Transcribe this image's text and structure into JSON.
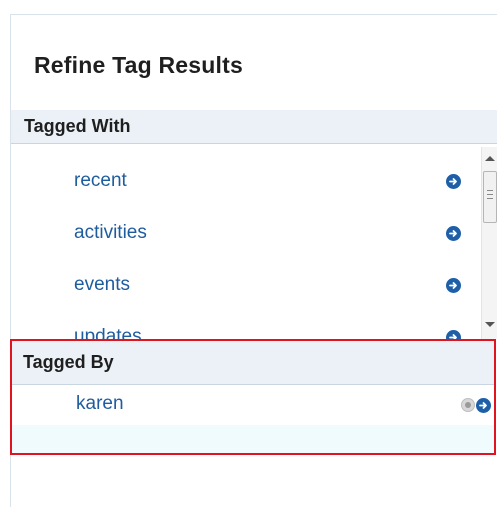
{
  "panel": {
    "title": "Refine Tag Results"
  },
  "tagged_with": {
    "header": "Tagged With",
    "items": [
      {
        "label": "recent"
      },
      {
        "label": "activities"
      },
      {
        "label": "events"
      },
      {
        "label": "updates"
      }
    ],
    "scroll_position": 0.1
  },
  "tagged_by": {
    "header": "Tagged By",
    "items": [
      {
        "label": "karen"
      }
    ]
  },
  "colors": {
    "link": "#1f5c9e",
    "button": "#1e5fa8",
    "header_bg": "#ebf1f6",
    "highlight_border": "#e0141e"
  },
  "icons": {
    "go": "arrow-right-circle-icon",
    "remove": "remove-filter-icon"
  }
}
